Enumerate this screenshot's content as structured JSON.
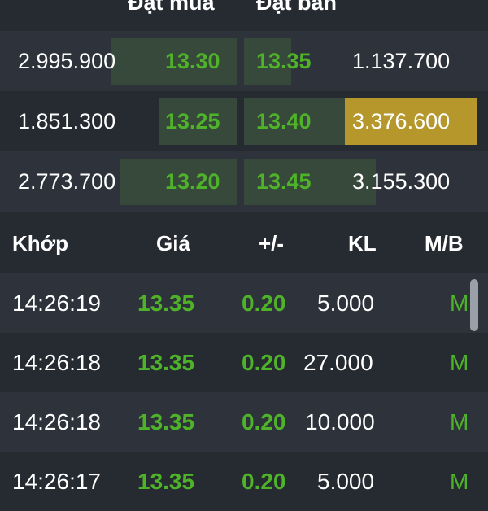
{
  "order_book": {
    "header": {
      "bid_label": "Đặt mua",
      "ask_label": "Đặt bán"
    },
    "rows": [
      {
        "bid_volume": "2.995.900",
        "bid_price": "13.30",
        "ask_price": "13.35",
        "ask_volume": "1.137.700"
      },
      {
        "bid_volume": "1.851.300",
        "bid_price": "13.25",
        "ask_price": "13.40",
        "ask_volume": "3.376.600"
      },
      {
        "bid_volume": "2.773.700",
        "bid_price": "13.20",
        "ask_price": "13.45",
        "ask_volume": "3.155.300"
      }
    ]
  },
  "matched": {
    "header": {
      "time": "Khớp",
      "price": "Giá",
      "change": "+/-",
      "volume": "KL",
      "side": "M/B"
    },
    "rows": [
      {
        "time": "14:26:19",
        "price": "13.35",
        "change": "0.20",
        "volume": "5.000",
        "side": "M"
      },
      {
        "time": "14:26:18",
        "price": "13.35",
        "change": "0.20",
        "volume": "27.000",
        "side": "M"
      },
      {
        "time": "14:26:18",
        "price": "13.35",
        "change": "0.20",
        "volume": "10.000",
        "side": "M"
      },
      {
        "time": "14:26:17",
        "price": "13.35",
        "change": "0.20",
        "volume": "5.000",
        "side": "M"
      }
    ]
  },
  "colors": {
    "background": "#262a31",
    "row_alt": "#2e323a",
    "up_green": "#4fb32a",
    "depth_bar": "#36493a",
    "highlight": "#b5972c"
  }
}
